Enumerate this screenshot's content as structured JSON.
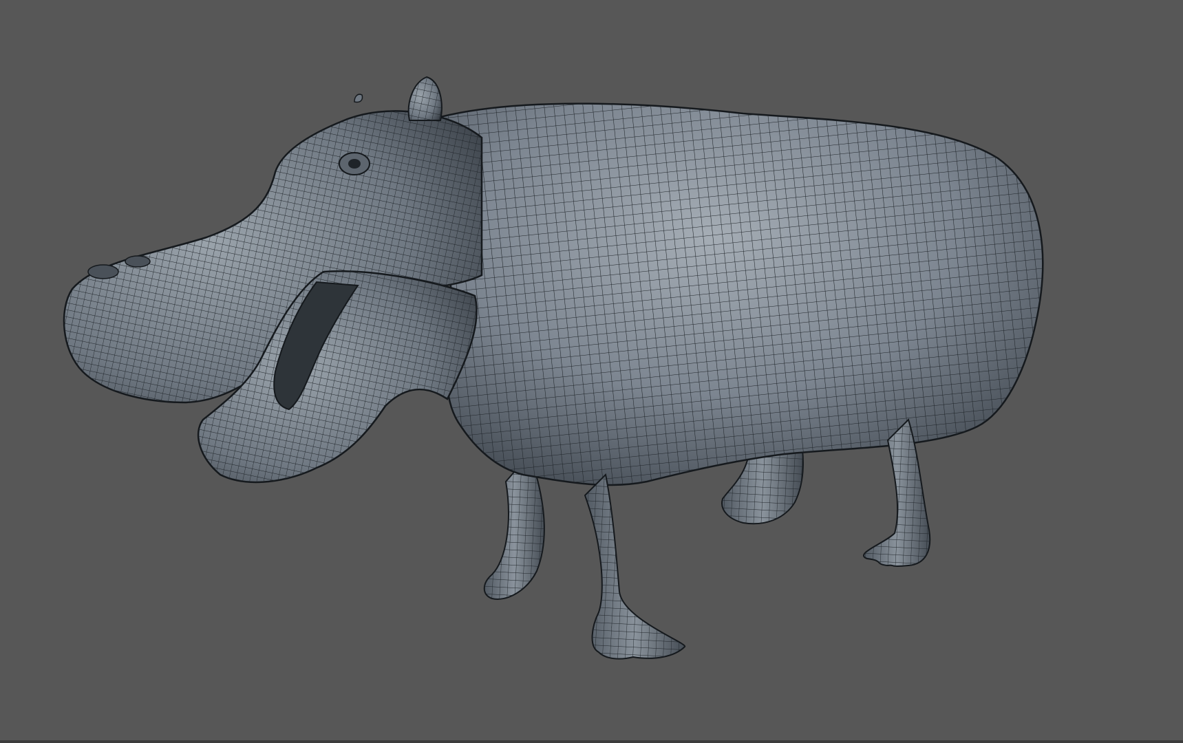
{
  "viewport": {
    "background_color": "#575757",
    "bottom_border_color": "#3c3c3c"
  },
  "model": {
    "subject": "hippopotamus",
    "display_mode": "wireframe-on-shaded",
    "surface_color": "#7c8590",
    "surface_highlight_color": "#a5adb5",
    "surface_shadow_color": "#3f464e",
    "wire_color": "#1e2328",
    "outline_color": "#15191d"
  }
}
